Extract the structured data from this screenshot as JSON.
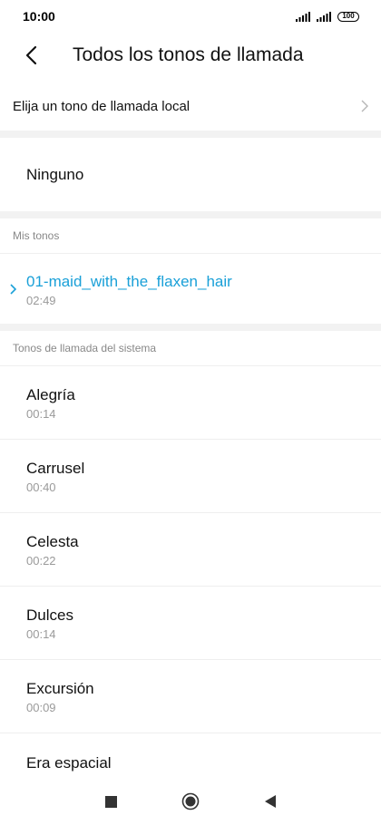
{
  "status": {
    "time": "10:00",
    "battery": "100"
  },
  "header": {
    "title": "Todos los tonos de llamada"
  },
  "local_option": {
    "label": "Elija un tono de llamada local"
  },
  "none_option": {
    "label": "Ninguno"
  },
  "my_tones": {
    "header": "Mis tonos",
    "items": [
      {
        "name": "01-maid_with_the_flaxen_hair",
        "duration": "02:49",
        "selected": true
      }
    ]
  },
  "system_tones": {
    "header": "Tonos de llamada del sistema",
    "items": [
      {
        "name": "Alegría",
        "duration": "00:14"
      },
      {
        "name": "Carrusel",
        "duration": "00:40"
      },
      {
        "name": "Celesta",
        "duration": "00:22"
      },
      {
        "name": "Dulces",
        "duration": "00:14"
      },
      {
        "name": "Excursión",
        "duration": "00:09"
      },
      {
        "name": "Era espacial",
        "duration": ""
      }
    ]
  },
  "colors": {
    "accent": "#1aa0d8",
    "background": "#ffffff",
    "band": "#f2f2f2"
  }
}
